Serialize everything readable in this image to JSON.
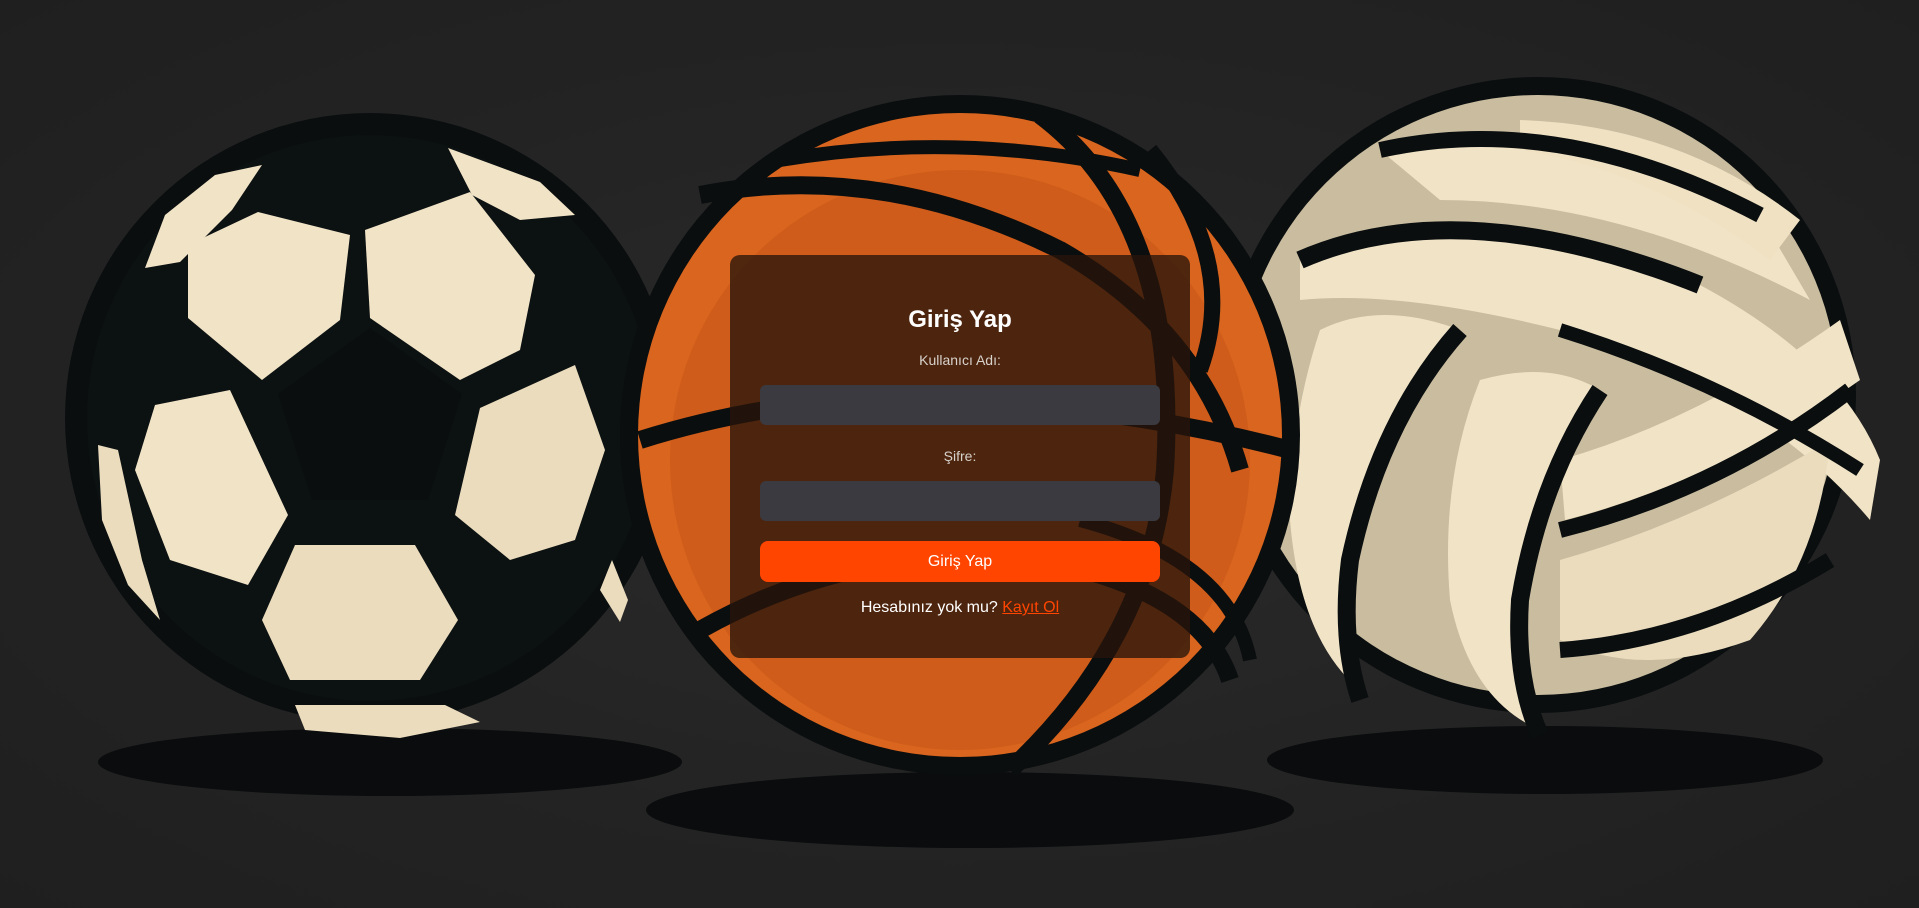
{
  "login": {
    "title": "Giriş Yap",
    "username_label": "Kullanıcı Adı:",
    "username_value": "",
    "password_label": "Şifre:",
    "password_value": "",
    "submit_label": "Giriş Yap",
    "register_prompt": "Hesabınız yok mu?",
    "register_link": "Kayıt Ol"
  },
  "background": {
    "balls": [
      "soccer-ball-icon",
      "basketball-icon",
      "volleyball-icon"
    ]
  },
  "colors": {
    "accent": "#ff4500",
    "background": "#252525",
    "input_bg": "#3a3a40",
    "card_bg": "#28140a",
    "ball_cream": "#f1e3c6",
    "ball_dark": "#0a0e0f",
    "basketball_orange": "#d9651e"
  }
}
